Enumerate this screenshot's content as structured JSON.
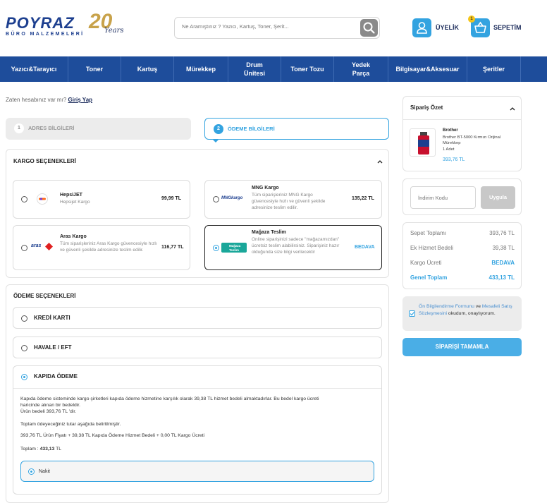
{
  "header": {
    "logo_main": "POYRAZ",
    "logo_sub": "BÜRO MALZEMELERİ",
    "logo_anniversary": "20",
    "logo_years": "Years",
    "search_placeholder": "Ne Aramıştınız ? Yazıcı, Kartuş, Toner, Şerit...",
    "user_label": "ÜYELİK",
    "cart_label": "SEPETİM",
    "cart_count": "1"
  },
  "nav": [
    "Yazıcı&Tarayıcı",
    "Toner",
    "Kartuş",
    "Mürekkep",
    "Drum Ünitesi",
    "Toner Tozu",
    "Yedek Parça",
    "Bilgisayar&Aksesuar",
    "Şeritler"
  ],
  "login": {
    "prompt": "Zaten hesabınız var mı?",
    "link": "Giriş Yap"
  },
  "steps": [
    {
      "num": "1",
      "label": "ADRES BİLGİLERİ"
    },
    {
      "num": "2",
      "label": "ÖDEME BİLGİLERİ"
    }
  ],
  "cargo": {
    "title": "KARGO SEÇENEKLERİ",
    "options": [
      {
        "name": "HepsiJET",
        "desc": "Hepsijet Kargo",
        "price": "99,99 TL",
        "logo": "hepsijet-logo"
      },
      {
        "name": "MNG Kargo",
        "desc": "Tüm siparişleriniz MNG Kargo güvencesiyle hızlı ve güvenli şekilde adresinize teslim edilir.",
        "price": "135,22 TL",
        "logo": "mng-logo",
        "logo_text": "MNGkargo"
      },
      {
        "name": "Aras Kargo",
        "desc": "Tüm siparişleriniz Aras Kargo güvencesiyle hızlı ve güvenli şekilde adresinize teslim edilir.",
        "price": "116,77 TL",
        "logo": "aras-logo",
        "logo_text": "aras"
      },
      {
        "name": "Mağaza Teslim",
        "desc": "Online siparişinizi sadece \"mağazamızdan\" ücretsiz teslim alabilirsiniz. Siparişiniz hazır olduğunda size bilgi verilecektir",
        "price": "BEDAVA",
        "logo": "store-pickup-logo",
        "logo_text": "Mağaza Teslim"
      }
    ]
  },
  "payment": {
    "title": "ÖDEME SEÇENEKLERİ",
    "options": [
      "KREDİ KARTI",
      "HAVALE / EFT",
      "KAPIDA ÖDEME"
    ],
    "cod_info": {
      "line1": "Kapıda ödeme sisteminde kargo şirketleri kapıda ödeme hizmetine karşılık olarak 39,38 TL hizmet bedeli almaktadırlar. Bu bedel kargo ücreti",
      "line2": "haricinde alınan bir bedeldir.",
      "line3": "Ürün bedeli 393,76 TL 'dir.",
      "line4": "Toplam ödeyeceğiniz tutar aşağıda belirtilmiştir.",
      "line5": "393,76 TL Ürün Fiyatı + 39,38 TL Kapıda Ödeme Hizmet Bedeli + 0,00 TL Kargo Ücreti",
      "total_label": "Toplam :",
      "total_value": "433,13",
      "total_unit": "TL"
    },
    "cash_label": "Nakit"
  },
  "summary": {
    "title": "Sipariş Özet",
    "product_brand": "Brother",
    "product_name": "Brother BT-5000 Kırmızı Orijinal Mürekkep",
    "product_qty": "1 Adet",
    "product_price": "393,76 TL"
  },
  "coupon": {
    "placeholder": "İndirim Kodu",
    "button": "Uygula"
  },
  "totals": {
    "rows": [
      {
        "label": "Sepet Toplamı",
        "value": "393,76 TL"
      },
      {
        "label": "Ek Hizmet Bedeli",
        "value": "39,38 TL"
      },
      {
        "label": "Kargo Ücreti",
        "value": "BEDAVA"
      },
      {
        "label": "Genel Toplam",
        "value": "433,13 TL"
      }
    ]
  },
  "agreement": {
    "link1": "Ön Bilgilendirme Formunu",
    "and": " ve ",
    "link2": "Mesafeli Satış Sözleşmesini",
    "suffix": " okudum, onaylıyorum."
  },
  "complete_button": "SİPARİŞİ TAMAMLA"
}
